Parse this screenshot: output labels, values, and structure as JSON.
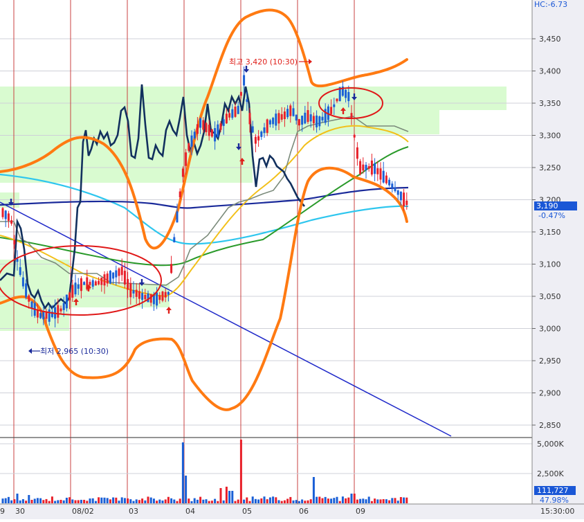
{
  "hc_label": "HC:-6.73",
  "price_axis": {
    "ticks": [
      "3,450",
      "3,400",
      "3,350",
      "3,300",
      "3,250",
      "3,200",
      "3,150",
      "3,100",
      "3,050",
      "3,000",
      "2,950",
      "2,900",
      "2,850"
    ],
    "current_price": "3,190",
    "current_change": "-0.47%"
  },
  "volume_axis": {
    "ticks": [
      "5,000K",
      "2,500K"
    ],
    "current_volume": "111,727",
    "current_ratio": "47.98%"
  },
  "time_axis": {
    "date_labels": [
      "30",
      "08/02",
      "03",
      "04",
      "05",
      "06",
      "09"
    ],
    "left_partial_label": "9",
    "time_label": "15:30:00"
  },
  "annotations": {
    "high_label": "최고 3,420 (10:30)",
    "low_label": "최저 2,965 (10:30)"
  },
  "colors": {
    "up_candle": "#e8202a",
    "down_candle": "#1a5fd6",
    "bollinger": "#ff7a12",
    "trendline": "#1f29c9",
    "highlight_zone": "#d9fbd0",
    "circle": "#e01818",
    "current_price_box": "#1a57d6"
  },
  "chart_data": {
    "type": "candlestick",
    "yaxis_range": [
      2840,
      3480
    ],
    "y_ticks": [
      3450,
      3400,
      3350,
      3300,
      3250,
      3200,
      3150,
      3100,
      3050,
      3000,
      2950,
      2900,
      2850
    ],
    "x_day_labels": [
      "30",
      "08/02",
      "03",
      "04",
      "05",
      "06",
      "09"
    ],
    "current_price": 3190,
    "change_pct": -0.47,
    "high": {
      "price": 3420,
      "time": "10:30"
    },
    "low": {
      "price": 2965,
      "time": "10:30"
    },
    "volume_axis_ticks": [
      5000000,
      2500000
    ],
    "current_volume": 111727,
    "volume_ratio_pct": 47.98
  }
}
